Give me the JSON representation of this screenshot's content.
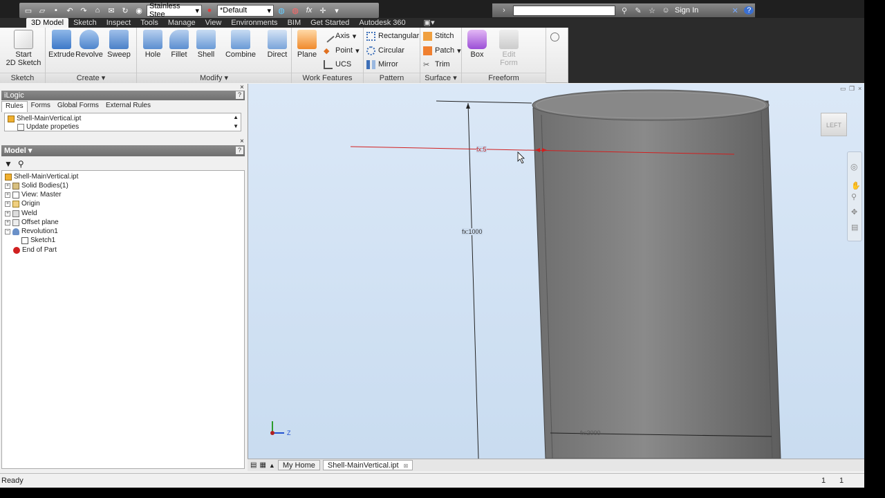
{
  "qat": {
    "material": "Stainless Stee",
    "appearance": "*Default",
    "fx": "fx"
  },
  "search": {
    "placeholder": "",
    "signin": "Sign In"
  },
  "tabs": [
    "3D Model",
    "Sketch",
    "Inspect",
    "Tools",
    "Manage",
    "View",
    "Environments",
    "BIM",
    "Get Started",
    "Autodesk 360"
  ],
  "ribbon": {
    "sketch_panel": {
      "title": "Sketch",
      "start_line1": "Start",
      "start_line2": "2D Sketch"
    },
    "create_panel": {
      "title": "Create",
      "extrude": "Extrude",
      "revolve": "Revolve",
      "sweep": "Sweep"
    },
    "modify_panel": {
      "title": "Modify",
      "hole": "Hole",
      "fillet": "Fillet",
      "shell": "Shell",
      "combine": "Combine",
      "direct": "Direct"
    },
    "work_panel": {
      "title": "Work Features",
      "plane": "Plane",
      "axis": "Axis",
      "point": "Point",
      "ucs": "UCS"
    },
    "pattern_panel": {
      "title": "Pattern",
      "rectangular": "Rectangular",
      "circular": "Circular",
      "mirror": "Mirror"
    },
    "surface_panel": {
      "title": "Surface",
      "stitch": "Stitch",
      "patch": "Patch",
      "trim": "Trim"
    },
    "freeform_panel": {
      "title": "Freeform",
      "box": "Box",
      "edit_line1": "Edit",
      "edit_line2": "Form"
    }
  },
  "ilogic": {
    "title": "iLogic",
    "tabs": [
      "Rules",
      "Forms",
      "Global Forms",
      "External Rules"
    ],
    "file": "Shell-MainVertical.ipt",
    "rule": "Update propeties"
  },
  "model": {
    "title": "Model",
    "items": [
      "Shell-MainVertical.ipt",
      "Solid Bodies(1)",
      "View: Master",
      "Origin",
      "Weld",
      "Offset plane",
      "Revolution1",
      "Sketch1",
      "End of Part"
    ]
  },
  "viewport": {
    "viewcube": "LEFT",
    "dim_top": "fx:5",
    "dim_height": "fx:1000",
    "dim_bottom": "fx:2000",
    "axis_z": "Z"
  },
  "doctabs": {
    "home": "My Home",
    "file": "Shell-MainVertical.ipt"
  },
  "status": {
    "text": "Ready",
    "num1": "1",
    "num2": "1"
  },
  "colors": {
    "accent": "#0a5bc4",
    "sketch_red": "#d21e1e"
  }
}
